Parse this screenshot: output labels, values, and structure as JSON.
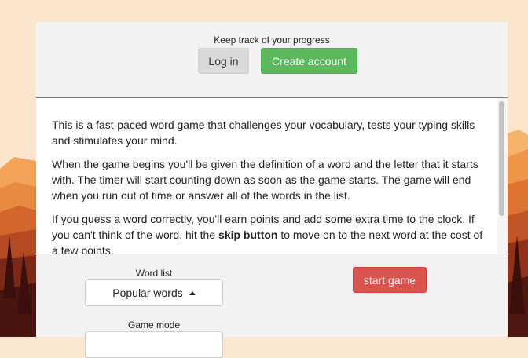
{
  "header": {
    "caption": "Keep track of your progress",
    "login_label": "Log in",
    "create_account_label": "Create account"
  },
  "content": {
    "paragraph_1": "This is a fast-paced word game that challenges your vocabulary, tests your typing skills and stimulates your mind.",
    "paragraph_2": "When the game begins you'll be given the definition of a word and the letter that it starts with. The timer will start counting down as soon as the game starts. The game will end when you run out of time or answer all of the words in the list.",
    "paragraph_3_start": "If you guess a word correctly, you'll earn points and add some extra time to the clock. If you can't think of the word, hit the ",
    "paragraph_3_bold": "skip button",
    "paragraph_3_end": " to move on to the next word at the cost of a few points."
  },
  "controls": {
    "word_list_label": "Word list",
    "word_list_value": "Popular words",
    "game_mode_label": "Game mode",
    "start_label": "start game"
  },
  "colors": {
    "login_bg": "#d9d9d9",
    "create_account_bg": "#5cb85c",
    "start_bg": "#d9534f",
    "panel_bg": "#f2f2f2"
  },
  "icons": {
    "word_list_caret": "caret-up-icon"
  }
}
